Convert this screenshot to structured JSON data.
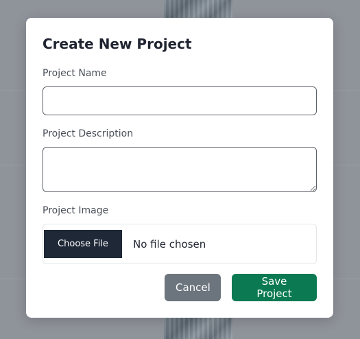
{
  "modal": {
    "title": "Create New Project",
    "fields": {
      "name": {
        "label": "Project Name",
        "value": "",
        "placeholder": ""
      },
      "description": {
        "label": "Project Description",
        "value": "",
        "placeholder": ""
      },
      "image": {
        "label": "Project Image",
        "button_label": "Choose File",
        "status": "No file chosen"
      }
    },
    "actions": {
      "cancel_label": "Cancel",
      "save_label": "Save Project"
    }
  },
  "colors": {
    "save_button": "#0b7a52",
    "cancel_button": "#6c757e",
    "file_button": "#1f2837",
    "overlay": "#8f939a"
  }
}
